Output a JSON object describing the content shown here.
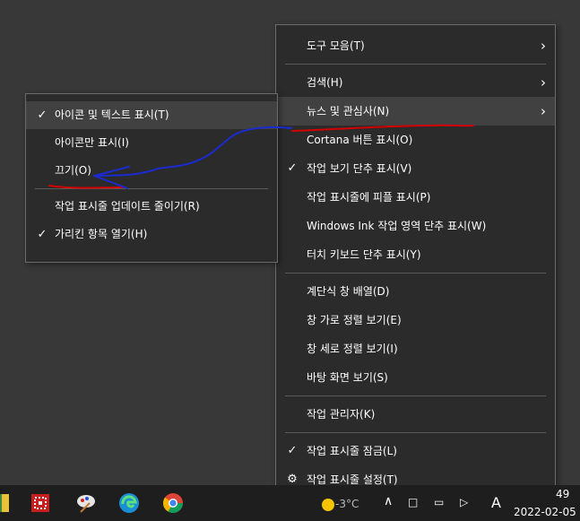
{
  "main_menu": {
    "items": [
      {
        "label": "도구 모음(T)",
        "has_submenu": true
      },
      {
        "label": "검색(H)",
        "has_submenu": true
      },
      {
        "label": "뉴스 및 관심사(N)",
        "has_submenu": true,
        "highlighted": true
      },
      {
        "label": "Cortana 버튼 표시(O)"
      },
      {
        "label": "작업 보기 단추 표시(V)",
        "checked": true
      },
      {
        "label": "작업 표시줄에 피플 표시(P)"
      },
      {
        "label": "Windows Ink 작업 영역 단추 표시(W)"
      },
      {
        "label": "터치 키보드 단추 표시(Y)"
      },
      {
        "label": "계단식 창 배열(D)"
      },
      {
        "label": "창 가로 정렬 보기(E)"
      },
      {
        "label": "창 세로 정렬 보기(I)"
      },
      {
        "label": "바탕 화면 보기(S)"
      },
      {
        "label": "작업 관리자(K)"
      },
      {
        "label": "작업 표시줄 잠금(L)",
        "checked": true
      },
      {
        "label": "작업 표시줄 설정(T)",
        "icon": "gear-icon"
      }
    ]
  },
  "sub_menu": {
    "items": [
      {
        "label": "아이콘 및 텍스트 표시(T)",
        "checked": true,
        "highlighted": true
      },
      {
        "label": "아이콘만 표시(I)"
      },
      {
        "label": "끄기(O)",
        "annotated": true
      },
      {
        "label": "작업 표시줄 업데이트 줄이기(R)"
      },
      {
        "label": "가리킨 항목 열기(H)",
        "checked": true
      }
    ]
  },
  "taskbar": {
    "apps": [
      "file-icon",
      "red-app-icon",
      "paint-app-icon",
      "edge-icon",
      "chrome-icon"
    ],
    "weather": "-3°C",
    "ime": "A",
    "time": "49",
    "date": "2022-02-05"
  },
  "annotation_colors": {
    "underline": "#d40000",
    "arrow": "#1a2bd0"
  }
}
